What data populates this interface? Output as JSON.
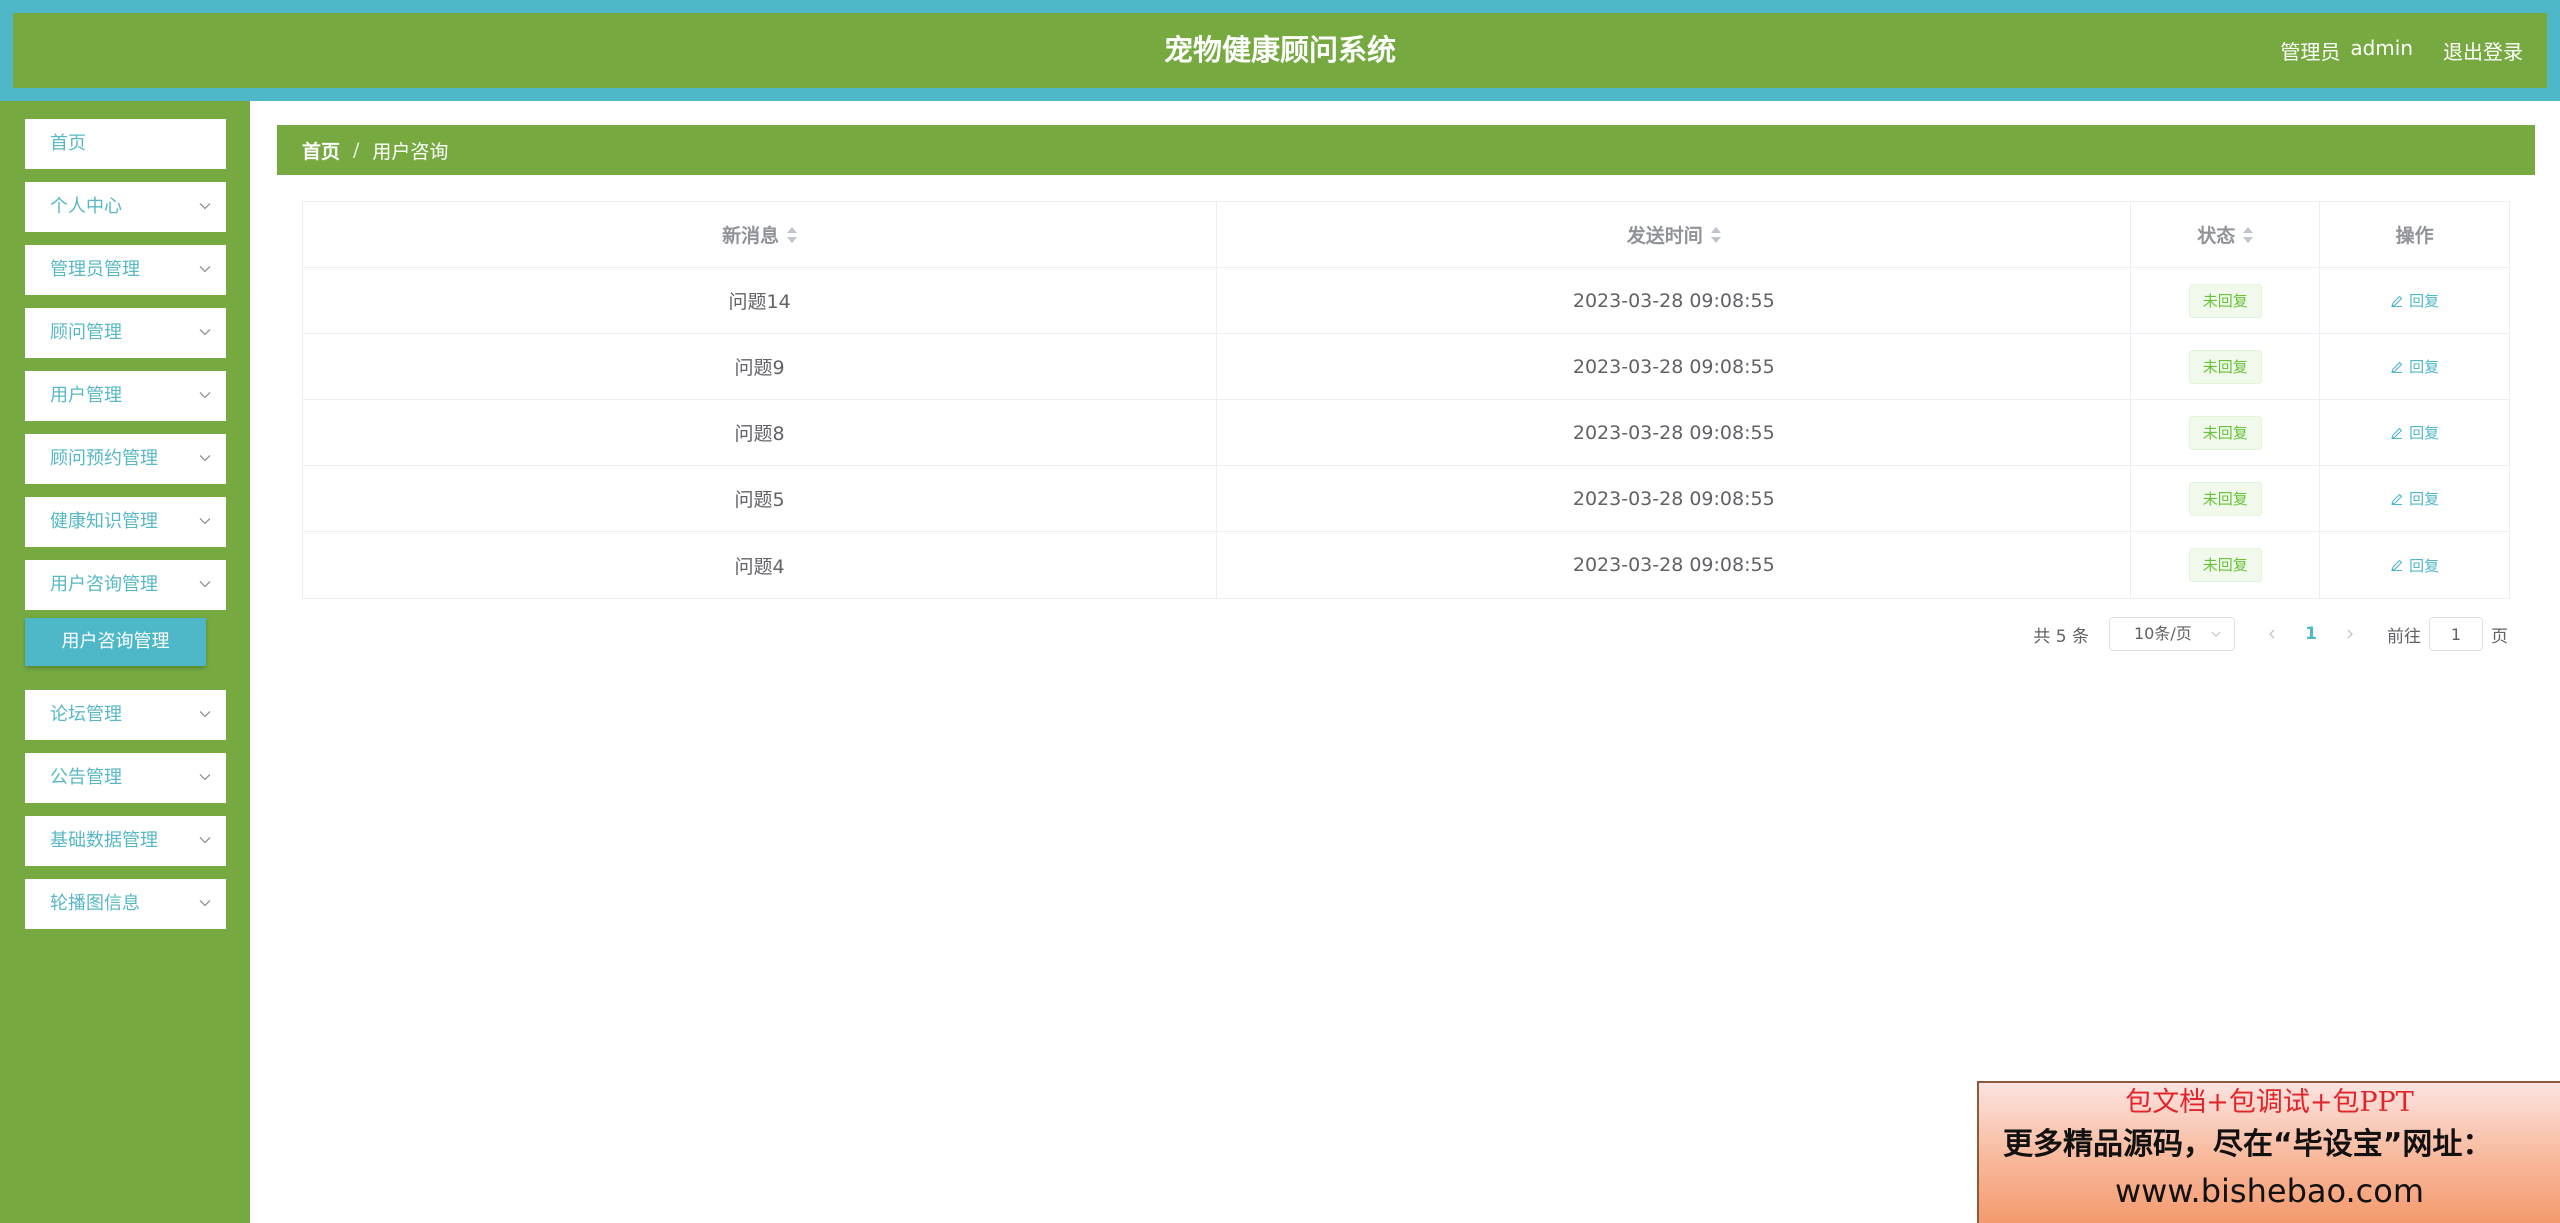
{
  "header": {
    "title": "宠物健康顾问系统",
    "role": "管理员",
    "username": "admin",
    "logout_label": "退出登录"
  },
  "sidebar": {
    "items": [
      {
        "label": "首页",
        "expandable": false
      },
      {
        "label": "个人中心",
        "expandable": true
      },
      {
        "label": "管理员管理",
        "expandable": true
      },
      {
        "label": "顾问管理",
        "expandable": true
      },
      {
        "label": "用户管理",
        "expandable": true
      },
      {
        "label": "顾问预约管理",
        "expandable": true
      },
      {
        "label": "健康知识管理",
        "expandable": true
      },
      {
        "label": "用户咨询管理",
        "expandable": true
      },
      {
        "label": "论坛管理",
        "expandable": true
      },
      {
        "label": "公告管理",
        "expandable": true
      },
      {
        "label": "基础数据管理",
        "expandable": true
      },
      {
        "label": "轮播图信息",
        "expandable": true
      }
    ],
    "submenu_active": "用户咨询管理"
  },
  "breadcrumb": {
    "home": "首页",
    "separator": "/",
    "current": "用户咨询"
  },
  "table": {
    "columns": [
      "新消息",
      "发送时间",
      "状态",
      "操作"
    ],
    "rows": [
      {
        "message": "问题14",
        "time": "2023-03-28 09:08:55",
        "status": "未回复",
        "action": "回复"
      },
      {
        "message": "问题9",
        "time": "2023-03-28 09:08:55",
        "status": "未回复",
        "action": "回复"
      },
      {
        "message": "问题8",
        "time": "2023-03-28 09:08:55",
        "status": "未回复",
        "action": "回复"
      },
      {
        "message": "问题5",
        "time": "2023-03-28 09:08:55",
        "status": "未回复",
        "action": "回复"
      },
      {
        "message": "问题4",
        "time": "2023-03-28 09:08:55",
        "status": "未回复",
        "action": "回复"
      }
    ]
  },
  "pagination": {
    "total_label": "共 5 条",
    "page_size": "10条/页",
    "current_page": "1",
    "goto_label": "前往",
    "goto_value": "1",
    "page_suffix": "页"
  },
  "promo": {
    "line1": "包文档+包调试+包PPT",
    "line2": "更多精品源码，尽在“毕设宝”网址：",
    "line3": "www.bishebao.com"
  },
  "colors": {
    "primary_green": "#76aa41",
    "header_teal": "#4fb8c8",
    "accent_teal": "#58b8c5",
    "tag_green": "#67c23a"
  },
  "icons": {
    "chevron": "chevron-down-icon",
    "edit": "edit-icon",
    "sort": "sort-icon",
    "prev": "chevron-left-icon",
    "next": "chevron-right-icon"
  }
}
